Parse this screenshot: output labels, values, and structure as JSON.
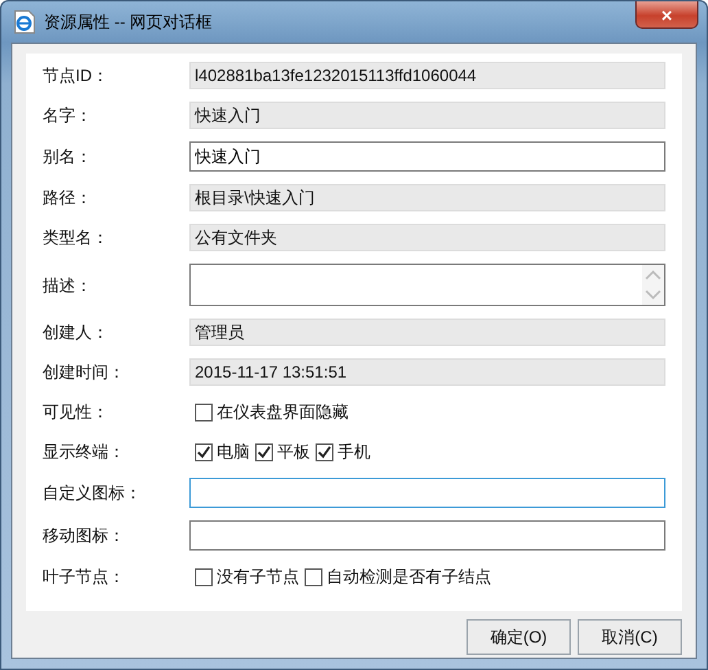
{
  "window": {
    "title": "资源属性 -- 网页对话框",
    "close": "×"
  },
  "fields": [
    {
      "kind": "readonly",
      "label": "节点ID：",
      "value": "l402881ba13fe1232015113ffd1060044"
    },
    {
      "kind": "readonly",
      "label": "名字：",
      "value": "快速入门"
    },
    {
      "kind": "input",
      "label": "别名：",
      "value": "快速入门",
      "focused": false
    },
    {
      "kind": "readonly",
      "label": "路径：",
      "value": "根目录\\快速入门"
    },
    {
      "kind": "readonly",
      "label": "类型名：",
      "value": "公有文件夹"
    },
    {
      "kind": "textarea",
      "label": "描述："
    },
    {
      "kind": "readonly",
      "label": "创建人：",
      "value": "管理员"
    },
    {
      "kind": "readonly",
      "label": "创建时间：",
      "value": "2015-11-17 13:51:51"
    },
    {
      "kind": "checks",
      "label": "可见性：",
      "options": [
        {
          "label": "在仪表盘界面隐藏",
          "checked": false
        }
      ]
    },
    {
      "kind": "checks",
      "label": "显示终端：",
      "options": [
        {
          "label": "电脑",
          "checked": true
        },
        {
          "label": "平板",
          "checked": true
        },
        {
          "label": "手机",
          "checked": true
        }
      ]
    },
    {
      "kind": "input",
      "label": "自定义图标：",
      "focused": true
    },
    {
      "kind": "input",
      "label": "移动图标：",
      "focused": false
    },
    {
      "kind": "checks",
      "label": "叶子节点：",
      "options": [
        {
          "label": "没有子节点",
          "checked": false
        },
        {
          "label": "自动检测是否有子结点",
          "checked": false
        }
      ]
    }
  ],
  "buttons": [
    "确定(O)",
    "取消(C)"
  ]
}
